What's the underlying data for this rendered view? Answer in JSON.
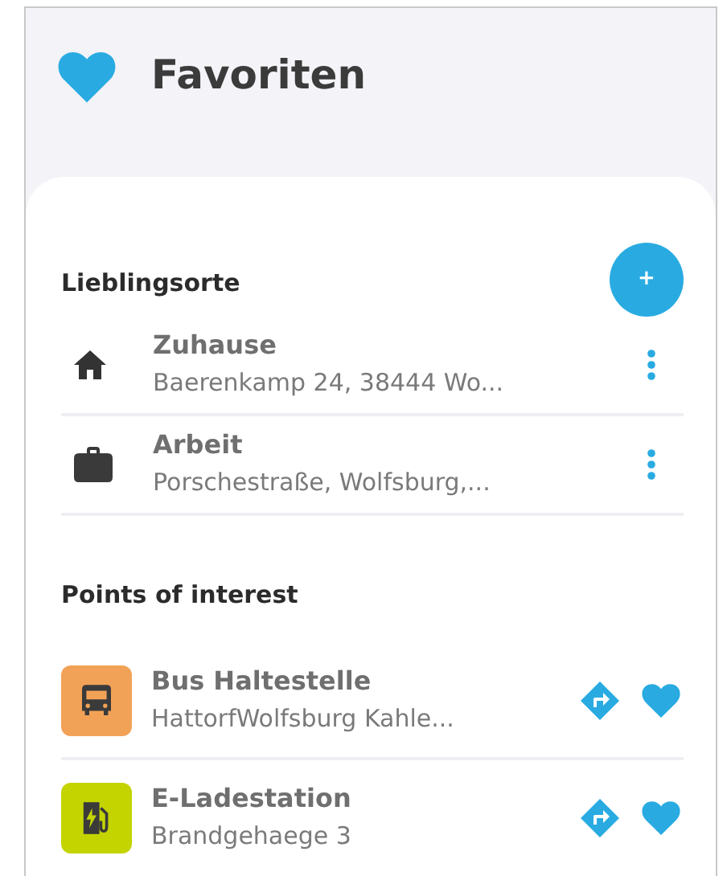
{
  "header": {
    "title": "Favoriten"
  },
  "favorite_places": {
    "title": "Lieblingsorte",
    "add_button": "+",
    "items": [
      {
        "kind": "home",
        "name": "Zuhause",
        "address": "Baerenkamp 24, 38444 Wo..."
      },
      {
        "kind": "work",
        "name": "Arbeit",
        "address": "Porschestraße, Wolfsburg,..."
      }
    ]
  },
  "points_of_interest": {
    "title": "Points of interest",
    "items": [
      {
        "kind": "bus",
        "color": "#f2a257",
        "name": "Bus Haltestelle",
        "address": "HattorfWolfsburg Kahle..."
      },
      {
        "kind": "charger",
        "color": "#c3d400",
        "name": "E-Ladestation",
        "address": "Brandgehaege 3"
      }
    ]
  }
}
